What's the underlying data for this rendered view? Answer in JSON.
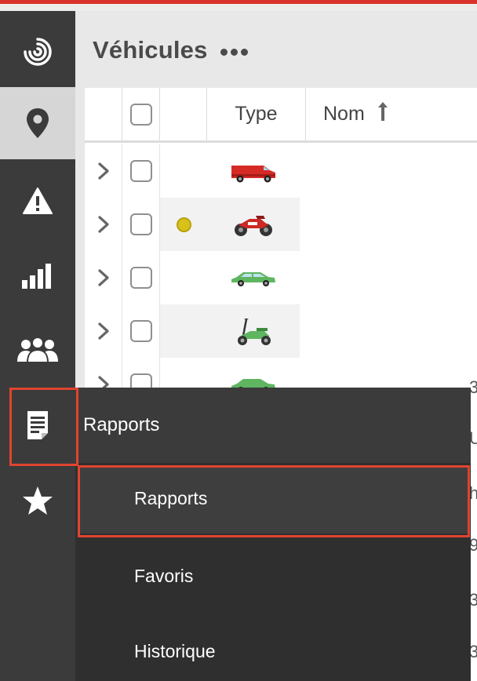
{
  "header": {
    "title": "Véhicules",
    "more_icon": "more-dots-icon"
  },
  "sidebar": {
    "items": [
      {
        "icon": "logo-swirl-icon",
        "active": false
      },
      {
        "icon": "map-pin-icon",
        "active": true
      },
      {
        "icon": "warning-icon",
        "active": false
      },
      {
        "icon": "bar-chart-icon",
        "active": false
      },
      {
        "icon": "users-icon",
        "active": false
      },
      {
        "icon": "report-document-icon",
        "active": false,
        "highlighted": true
      },
      {
        "icon": "star-icon",
        "active": false
      }
    ]
  },
  "table": {
    "columns": [
      "",
      "",
      "",
      "Type",
      "Nom"
    ],
    "sort": {
      "column": "Nom",
      "direction": "asc"
    },
    "rows": [
      {
        "type_icon": "red-van-icon",
        "status": null
      },
      {
        "type_icon": "red-motorcycle-icon",
        "status": "yellow"
      },
      {
        "type_icon": "green-car-icon",
        "status": null
      },
      {
        "type_icon": "green-scooter-icon",
        "status": null
      },
      {
        "type_icon": "green-car-icon",
        "status": null
      }
    ],
    "edge_fragments": [
      "3",
      "U",
      "h",
      "9",
      "3",
      "3"
    ]
  },
  "popup_menu": {
    "title": "Rapports",
    "items": [
      {
        "label": "Rapports",
        "highlighted": true
      },
      {
        "label": "Favoris",
        "highlighted": false
      },
      {
        "label": "Historique",
        "highlighted": false
      }
    ]
  },
  "colors": {
    "accent_red": "#d9322b",
    "highlight_outline": "#e0442f",
    "sidebar_bg": "#3b3b3b",
    "popup_bg": "#2f2f2f"
  }
}
